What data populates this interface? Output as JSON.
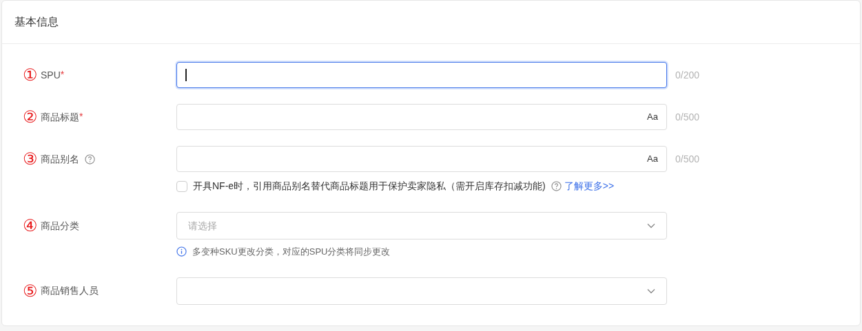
{
  "card": {
    "title": "基本信息"
  },
  "fields": [
    {
      "kind": "text",
      "marker": "①",
      "label": "SPU",
      "required_mark": "*",
      "focused": true,
      "counter": "0/200"
    },
    {
      "kind": "text",
      "marker": "②",
      "label": "商品标题",
      "required_mark": "*",
      "focused": false,
      "case_label": "Aa",
      "counter": "0/500"
    },
    {
      "kind": "text",
      "marker": "③",
      "label": "商品别名",
      "help": true,
      "focused": false,
      "case_label": "Aa",
      "counter": "0/500",
      "checkbox": {
        "checked": false,
        "label": "开具NF-e时，引用商品别名替代商品标题用于保护卖家隐私（需开启库存扣减功能)",
        "link": "了解更多>>"
      }
    },
    {
      "kind": "select",
      "marker": "④",
      "label": "商品分类",
      "focused": false,
      "placeholder": "请选择",
      "note": "多变种SKU更改分类，对应的SPU分类将同步更改"
    },
    {
      "kind": "select",
      "marker": "⑤",
      "label": "商品销售人员",
      "focused": false
    }
  ]
}
